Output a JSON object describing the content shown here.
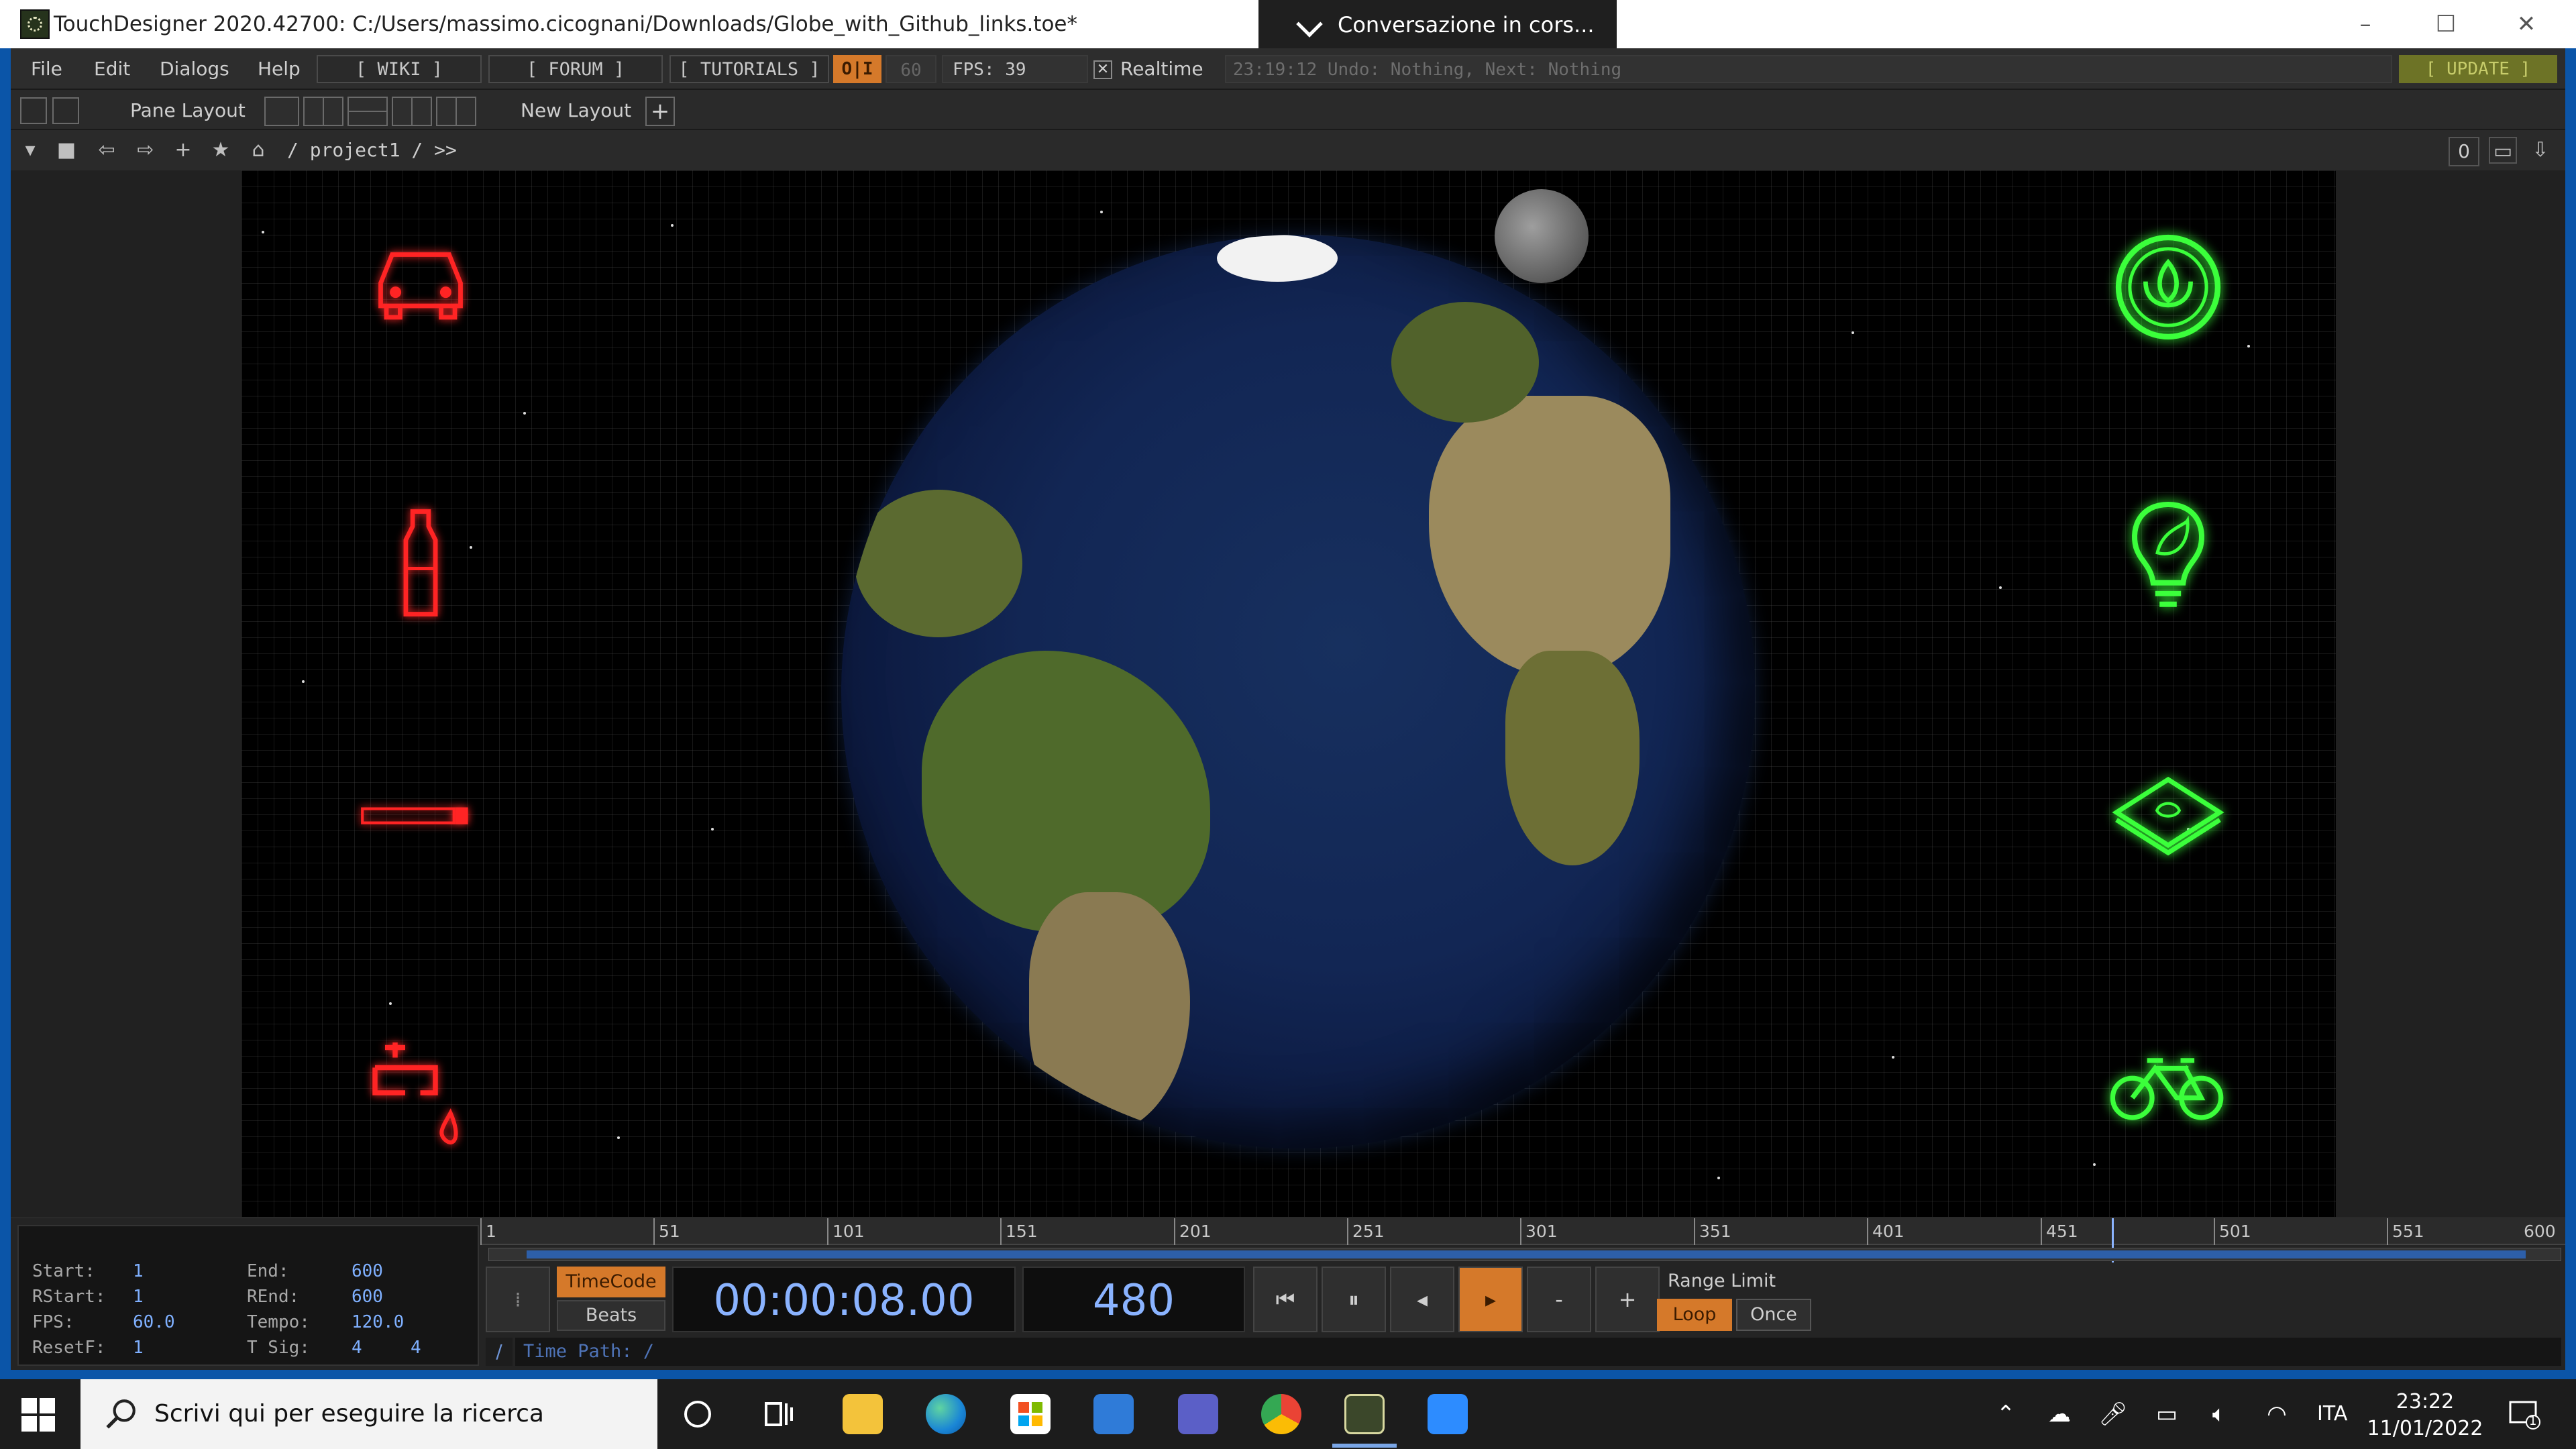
{
  "window": {
    "title": "TouchDesigner 2020.42700: C:/Users/massimo.cicognani/Downloads/Globe_with_Github_links.toe*",
    "minimize": "–",
    "maximize": "☐",
    "close": "✕"
  },
  "teams_overlay": {
    "label": "Conversazione  in  cors..."
  },
  "menubar": {
    "items": [
      "File",
      "Edit",
      "Dialogs",
      "Help"
    ],
    "wiki": "[ WIKI ]",
    "forum": "[ FORUM ]",
    "tutorials": "[ TUTORIALS ]",
    "oi_label": "O|I",
    "cook_rate": "60",
    "fps": "FPS:  39",
    "realtime_label": "Realtime",
    "realtime_checked": true,
    "status": "23:19:12 Undo: Nothing, Next: Nothing",
    "update": "[ UPDATE ]"
  },
  "panebar": {
    "pane_layout": "Pane Layout",
    "new_layout": "New Layout"
  },
  "navbar": {
    "path": "/ project1 / >>",
    "zero": "0"
  },
  "viewer": {
    "left_icons": [
      "car-icon",
      "bottle-icon",
      "cigarette-icon",
      "faucet-icon"
    ],
    "right_icons": [
      "lotus-icon",
      "eco-bulb-icon",
      "eco-tray-icon",
      "bicycle-icon"
    ],
    "left_color": "#ff2222",
    "right_color": "#3bff3b"
  },
  "timeline": {
    "stats": {
      "start_label": "Start:",
      "start": "1",
      "end_label": "End:",
      "end": "600",
      "rstart_label": "RStart:",
      "rstart": "1",
      "rend_label": "REnd:",
      "rend": "600",
      "fps_label": "FPS:",
      "fps": "60.0",
      "tempo_label": "Tempo:",
      "tempo": "120.0",
      "resetf_label": "ResetF:",
      "resetf": "1",
      "tsig_label": "T Sig:",
      "tsig_a": "4",
      "tsig_b": "4"
    },
    "ticks": [
      "1",
      "51",
      "101",
      "151",
      "201",
      "251",
      "301",
      "351",
      "401",
      "451",
      "501",
      "551",
      "600"
    ],
    "current_frame_fraction": 0.8,
    "timecode_btn": "TimeCode",
    "beats_btn": "Beats",
    "timecode": "00:00:08.00",
    "frame": "480",
    "transport": {
      "rewind": "⏮",
      "pause": "⏸",
      "step_back": "◂",
      "play": "▸",
      "minus": "-",
      "plus": "+"
    },
    "range_limit": "Range Limit",
    "loop": "Loop",
    "once": "Once",
    "time_path_slash": "/",
    "time_path": "Time Path: /"
  },
  "taskbar": {
    "search_placeholder": "Scrivi qui per eseguire la ricerca",
    "apps": [
      "cortana-icon",
      "task-view-icon",
      "file-explorer-icon",
      "edge-icon",
      "store-icon",
      "mail-icon",
      "teams-icon",
      "chrome-icon",
      "touchdesigner-icon",
      "zoom-icon"
    ],
    "language": "ITA",
    "time": "23:22",
    "date": "11/01/2022",
    "notification_count": "1"
  }
}
